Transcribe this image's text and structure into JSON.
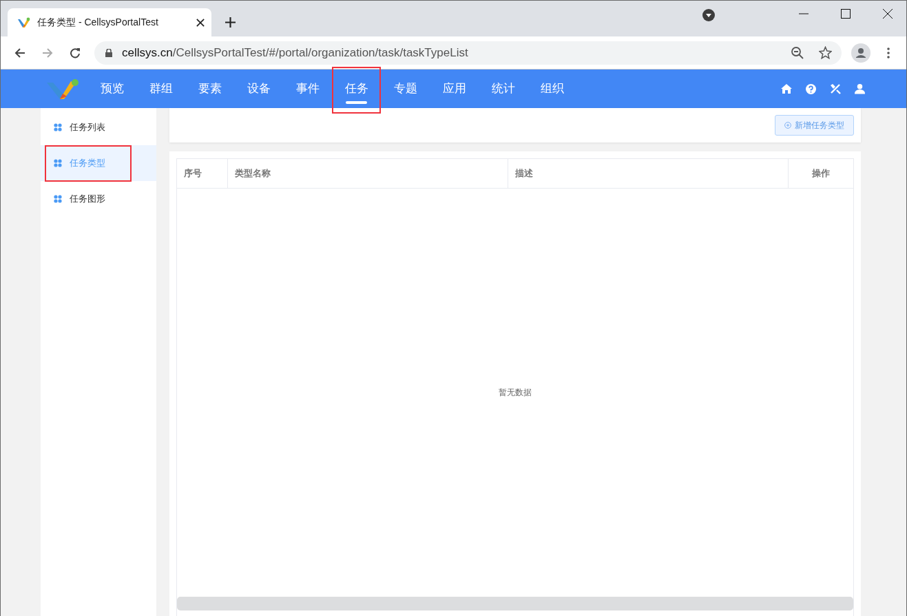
{
  "browser": {
    "tab_title": "任务类型 - CellsysPortalTest",
    "url_host": "cellsys.cn",
    "url_path": "/CellsysPortalTest/#/portal/organization/task/taskTypeList"
  },
  "nav": {
    "items": [
      {
        "label": "预览",
        "selected": false
      },
      {
        "label": "群组",
        "selected": false
      },
      {
        "label": "要素",
        "selected": false
      },
      {
        "label": "设备",
        "selected": false
      },
      {
        "label": "事件",
        "selected": false
      },
      {
        "label": "任务",
        "selected": true,
        "highlighted": true
      },
      {
        "label": "专题",
        "selected": false
      },
      {
        "label": "应用",
        "selected": false
      },
      {
        "label": "统计",
        "selected": false
      },
      {
        "label": "组织",
        "selected": false
      }
    ]
  },
  "sidebar": {
    "items": [
      {
        "label": "任务列表",
        "selected": false,
        "highlighted": false
      },
      {
        "label": "任务类型",
        "selected": true,
        "highlighted": true
      },
      {
        "label": "任务图形",
        "selected": false,
        "highlighted": false
      }
    ]
  },
  "toolbar": {
    "add_button": "新增任务类型"
  },
  "table": {
    "columns": [
      {
        "label": "序号",
        "kind": "left"
      },
      {
        "label": "类型名称",
        "kind": "left"
      },
      {
        "label": "描述",
        "kind": "left"
      },
      {
        "label": "操作",
        "kind": "center"
      }
    ],
    "empty_text": "暂无数据"
  }
}
